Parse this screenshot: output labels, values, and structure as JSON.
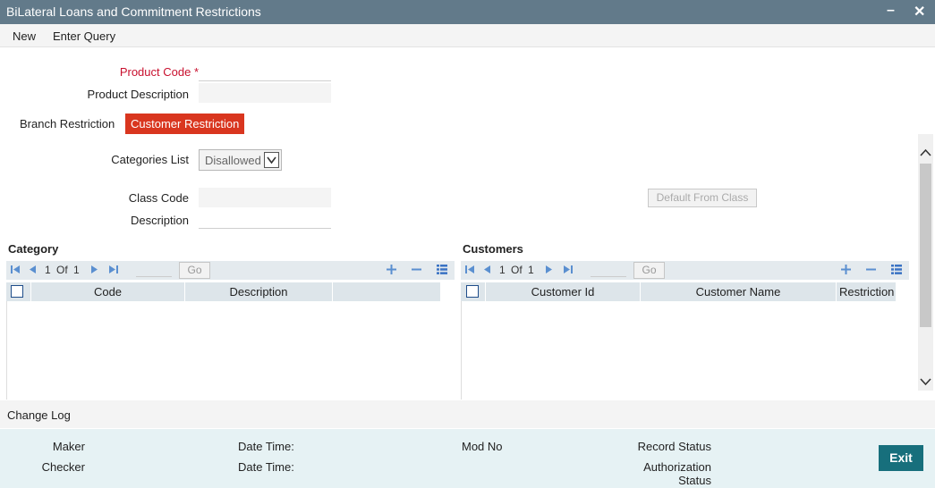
{
  "window": {
    "title": "BiLateral Loans and Commitment Restrictions"
  },
  "menu": {
    "new": "New",
    "enter_query": "Enter Query"
  },
  "form": {
    "product_code_label": "Product Code",
    "required_mark": "*",
    "product_code_value": "",
    "product_description_label": "Product Description",
    "product_description_value": ""
  },
  "tabs": [
    {
      "label": "Branch Restriction",
      "active": false
    },
    {
      "label": "Customer Restriction",
      "active": true
    }
  ],
  "customer_restriction": {
    "categories_list_label": "Categories List",
    "categories_list_value": "Disallowed",
    "class_code_label": "Class Code",
    "class_code_value": "",
    "description_label": "Description",
    "description_value": "",
    "default_from_class": "Default From Class"
  },
  "category_grid": {
    "title": "Category",
    "page": "1",
    "of_label": "Of",
    "total": "1",
    "go": "Go",
    "columns": [
      "Code",
      "Description"
    ],
    "rows": []
  },
  "customers_grid": {
    "title": "Customers",
    "page": "1",
    "of_label": "Of",
    "total": "1",
    "go": "Go",
    "columns": [
      "Customer Id",
      "Customer Name",
      "Restriction"
    ],
    "rows": []
  },
  "change_log": {
    "label": "Change Log"
  },
  "audit": {
    "maker": "Maker",
    "checker": "Checker",
    "date_time": "Date Time:",
    "mod_no": "Mod No",
    "record_status": "Record Status",
    "authorization_status_line1": "Authorization",
    "authorization_status_line2": "Status"
  },
  "exit": "Exit",
  "colors": {
    "titlebar": "#627a8a",
    "active_tab": "#d9361f",
    "required": "#c8102e",
    "exit": "#176f7c",
    "pager_icons": "#5a8fd0"
  }
}
